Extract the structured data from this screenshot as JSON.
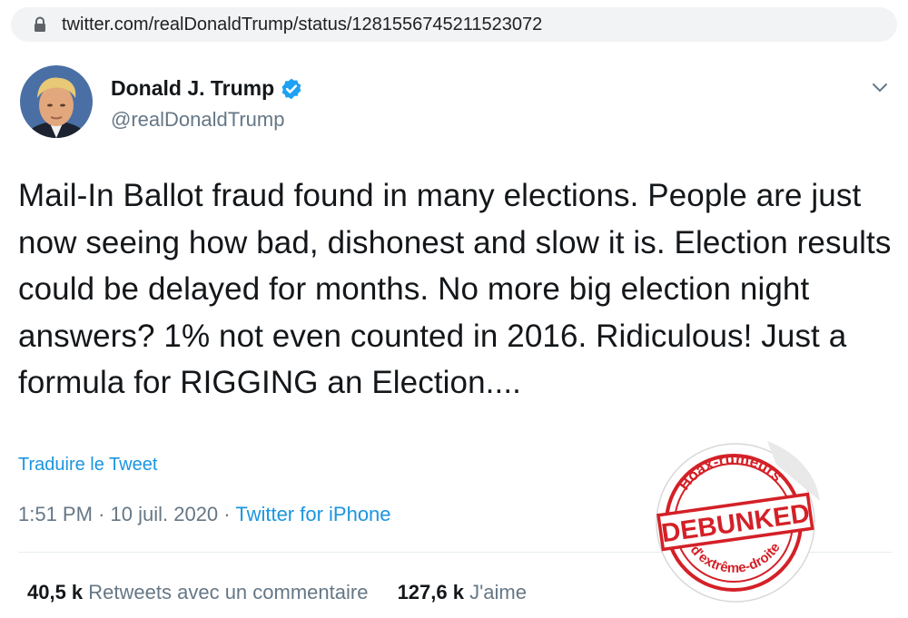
{
  "browser": {
    "url": "twitter.com/realDonaldTrump/status/1281556745211523072"
  },
  "tweet": {
    "author_name": "Donald J. Trump",
    "handle": "@realDonaldTrump",
    "text": "Mail-In Ballot fraud found in many elections. People are just now seeing how bad, dishonest and slow it is. Election results could be delayed for months. No more big election night answers? 1% not even counted in 2016. Ridiculous! Just a formula for RIGGING an Election....",
    "translate_label": "Traduire le Tweet",
    "time": "1:51 PM",
    "separator": "·",
    "date": "10 juil. 2020",
    "source": "Twitter for iPhone",
    "retweets_count": "40,5 k",
    "retweets_label": "Retweets avec un commentaire",
    "likes_count": "127,6 k",
    "likes_label": "J'aime"
  },
  "stamp": {
    "top_text": "Hoax-rumeurs",
    "main_text": "DEBUNKED",
    "bottom_text": "d'extrême-droite",
    "color": "#d42027"
  },
  "colors": {
    "link": "#1b95e0",
    "muted": "#657786",
    "text": "#14171a",
    "verified": "#1da1f2"
  },
  "icons": {
    "lock": "lock-icon",
    "verified": "verified-badge-icon",
    "caret": "chevron-down-icon"
  }
}
